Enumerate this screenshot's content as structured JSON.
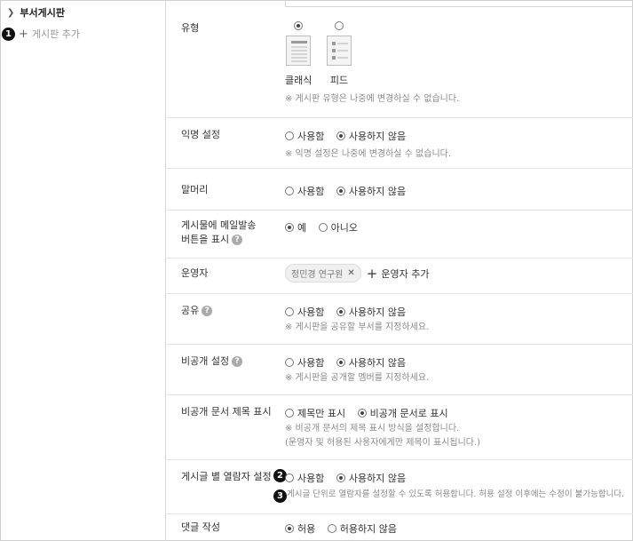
{
  "sidebar": {
    "tree_item": "부서게시판",
    "add_board": "게시판 추가",
    "callout_1": "1"
  },
  "settings": {
    "type": {
      "label": "유형",
      "options": [
        "클래식",
        "피드"
      ],
      "selected": "클래식",
      "note": "※ 게시판 유형은 나중에 변경하실 수 없습니다."
    },
    "anonymous": {
      "label": "익명 설정",
      "options": [
        "사용함",
        "사용하지 않음"
      ],
      "selected": "사용하지 않음",
      "note": "※ 익명 설정은 나중에 변경하실 수 없습니다."
    },
    "prefix": {
      "label": "말머리",
      "options": [
        "사용함",
        "사용하지 않음"
      ],
      "selected": "사용하지 않음"
    },
    "mail_button": {
      "label_line1": "게시물에 메일발송",
      "label_line2": "버튼을 표시",
      "options": [
        "예",
        "아니오"
      ],
      "selected": "예"
    },
    "operator": {
      "label": "운영자",
      "chip": "정민경 연구원",
      "add_label": "운영자 추가"
    },
    "share": {
      "label": "공유",
      "options": [
        "사용함",
        "사용하지 않음"
      ],
      "selected": "사용하지 않음",
      "note": "※ 게시판을 공유할 부서를 지정하세요."
    },
    "private": {
      "label": "비공개 설정",
      "options": [
        "사용함",
        "사용하지 않음"
      ],
      "selected": "사용하지 않음",
      "note": "※ 게시판을 공개할 멤버를 지정하세요."
    },
    "private_title": {
      "label": "비공개 문서 제목 표시",
      "options": [
        "제목만 표시",
        "비공개 문서로 표시"
      ],
      "selected": "비공개 문서로 표시",
      "note_line1": "※ 비공개 문서의 제목 표시 방식을 설정합니다.",
      "note_line2": "(운영자 및 허용된 사용자에게만 제목이 표시됩니다.)"
    },
    "viewer": {
      "label": "게시글 별 열람자 설정",
      "options": [
        "사용함",
        "사용하지 않음"
      ],
      "selected": "사용하지 않음",
      "note": "게시글 단위로 열람자를 설정할 수 있도록 허용합니다. 허용 설정 이후에는 수정이 불가능합니다.",
      "callout_2": "2",
      "callout_3": "3"
    },
    "comment": {
      "label": "댓글 작성",
      "options": [
        "허용",
        "허용하지 않음"
      ],
      "selected": "허용"
    }
  }
}
